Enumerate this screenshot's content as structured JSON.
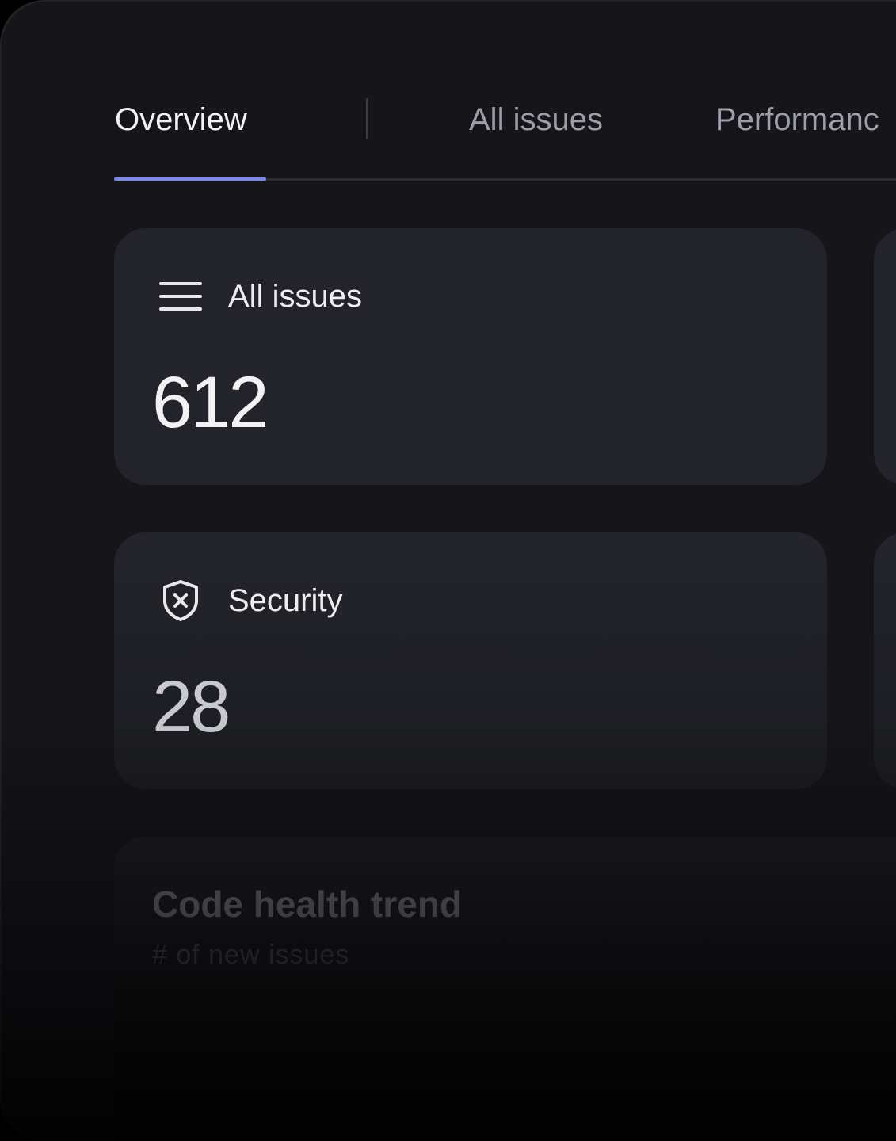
{
  "tabs": [
    {
      "label": "Overview",
      "active": true
    },
    {
      "label": "All issues",
      "active": false
    },
    {
      "label": "Performanc",
      "active": false
    }
  ],
  "colors": {
    "accent": "#7b86ee",
    "background": "#15151a",
    "card": "#23242b"
  },
  "cards": {
    "issues": {
      "label": "All issues",
      "value": "612",
      "icon": "list-icon"
    },
    "security": {
      "label": "Security",
      "value": "28",
      "icon": "shield-x-icon"
    }
  },
  "trend": {
    "title": "Code health trend",
    "subtitle": "# of new issues"
  }
}
